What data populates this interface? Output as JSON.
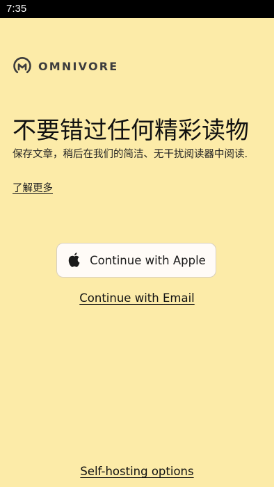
{
  "status_bar": {
    "time": "7:35"
  },
  "logo": {
    "icon": "omnivore-logo-icon",
    "wordmark": "OMNIVORE"
  },
  "hero": {
    "headline": "不要错过任何精彩读物",
    "subtitle": "保存文章，稍后在我们的简洁、无干扰阅读器中阅读.",
    "learn_more": "了解更多"
  },
  "actions": {
    "apple_icon": "apple-logo-icon",
    "apple_label": "Continue with Apple",
    "email_label": "Continue with Email",
    "self_hosting_label": "Self-hosting options"
  },
  "colors": {
    "background": "#FCEBA8",
    "status_bar": "#000000",
    "button_background": "#FFFBF7",
    "text": "#1A1A1A"
  }
}
